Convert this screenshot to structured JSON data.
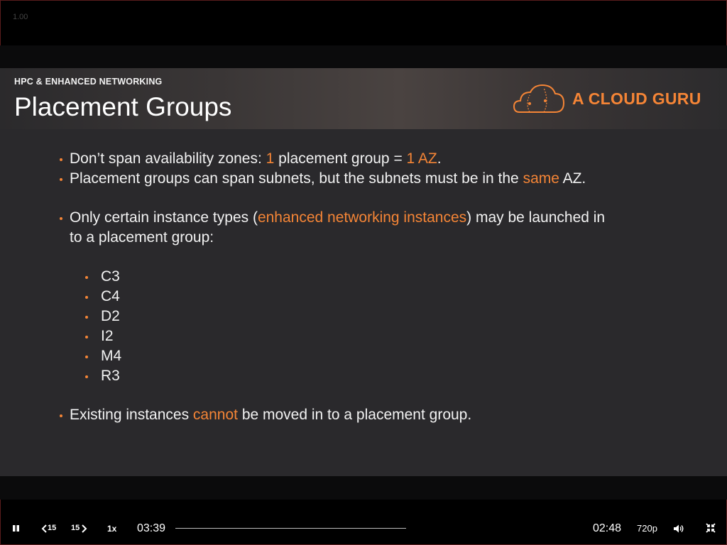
{
  "player": {
    "speed_readout": "1.00",
    "elapsed": "03:39",
    "remaining": "02:48",
    "rate_label": "1x",
    "quality_label": "720p",
    "skip_back_label": "15",
    "skip_forward_label": "15"
  },
  "slide": {
    "section_label": "HPC & ENHANCED NETWORKING",
    "title": "Placement Groups",
    "logo_text": "A CLOUD GURU",
    "accent_color": "#f58536",
    "bullets": {
      "b1": {
        "p1": "Don’t span availability zones: ",
        "p2": "1",
        "p3": " placement group = ",
        "p4": "1 AZ",
        "p5": "."
      },
      "b2": {
        "p1": "Placement groups can span subnets, but the subnets must be in the ",
        "p2": "same",
        "p3": " AZ."
      },
      "b3": {
        "p1": "Only certain instance types (",
        "p2": "enhanced networking instances",
        "p3": ") may be launched in",
        "line2": "to a placement group:"
      },
      "instance_types": [
        "C3",
        "C4",
        "D2",
        "I2",
        "M4",
        "R3"
      ],
      "b4": {
        "p1": "Existing instances ",
        "p2": "cannot",
        "p3": " be moved in to a placement group."
      }
    }
  }
}
